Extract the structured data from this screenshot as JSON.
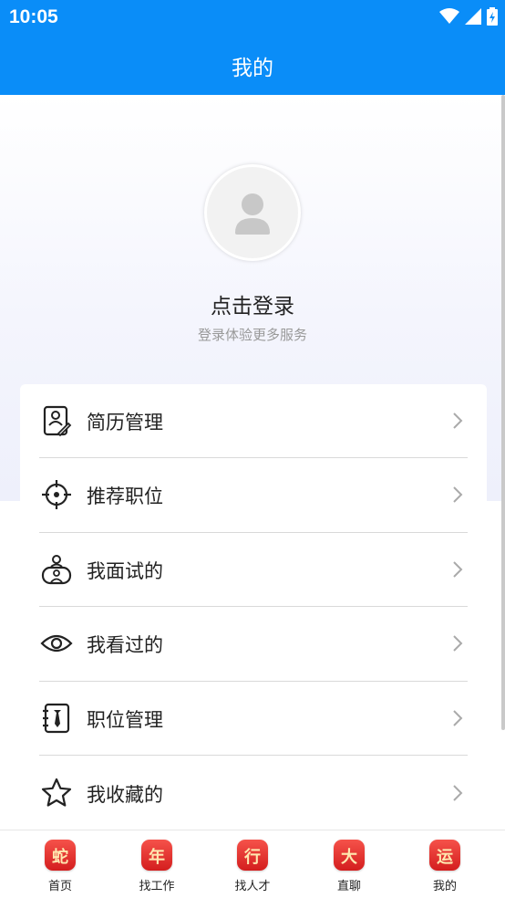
{
  "status_bar": {
    "time": "10:05"
  },
  "app_bar": {
    "title": "我的"
  },
  "profile": {
    "login_title": "点击登录",
    "login_subtitle": "登录体验更多服务"
  },
  "menu": [
    {
      "label": "简历管理",
      "icon": "resume-icon"
    },
    {
      "label": "推荐职位",
      "icon": "target-icon"
    },
    {
      "label": "我面试的",
      "icon": "interview-icon"
    },
    {
      "label": "我看过的",
      "icon": "eye-icon"
    },
    {
      "label": "职位管理",
      "icon": "job-manage-icon"
    },
    {
      "label": "我收藏的",
      "icon": "star-icon"
    }
  ],
  "tabs": [
    {
      "label": "首页",
      "glyph": "蛇"
    },
    {
      "label": "找工作",
      "glyph": "年"
    },
    {
      "label": "找人才",
      "glyph": "行"
    },
    {
      "label": "直聊",
      "glyph": "大"
    },
    {
      "label": "我的",
      "glyph": "运"
    }
  ],
  "colors": {
    "primary": "#0a8df8",
    "badge_red": "#e0302a"
  }
}
